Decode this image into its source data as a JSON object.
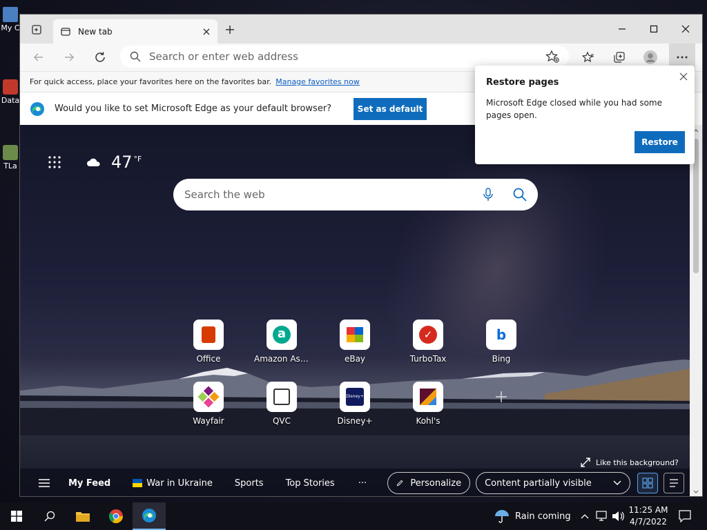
{
  "desktop": {
    "icons": [
      {
        "label": "My C"
      },
      {
        "label": "Data"
      },
      {
        "label": "TLa"
      }
    ]
  },
  "browser": {
    "tab_title": "New tab",
    "address_placeholder": "Search or enter web address",
    "favorites_bar": {
      "text": "For quick access, place your favorites here on the favorites bar.",
      "link": "Manage favorites now"
    },
    "default_prompt": {
      "text": "Would you like to set Microsoft Edge as your default browser?",
      "button": "Set as default"
    },
    "restore_popup": {
      "title": "Restore pages",
      "body": "Microsoft Edge closed while you had some pages open.",
      "button": "Restore"
    }
  },
  "newtab": {
    "weather": {
      "temp": "47",
      "unit": "°F"
    },
    "search_placeholder": "Search the web",
    "quick_links": [
      {
        "label": "Office",
        "color": "#d83b01"
      },
      {
        "label": "Amazon Assi...",
        "color": "#00a88f"
      },
      {
        "label": "eBay",
        "color": "#e53238"
      },
      {
        "label": "TurboTax",
        "color": "#d52b1e"
      },
      {
        "label": "Bing",
        "color": "#0a6dd8"
      },
      {
        "label": "Wayfair",
        "color": "#7f187f"
      },
      {
        "label": "QVC",
        "color": "#333333"
      },
      {
        "label": "Disney+",
        "color": "#0f1b5c"
      },
      {
        "label": "Kohl's",
        "color": "#5c0f2f"
      }
    ],
    "background_link": "Like this background?",
    "feed": {
      "my_feed": "My Feed",
      "war": "War in Ukraine",
      "sports": "Sports",
      "top_stories": "Top Stories",
      "more": "···",
      "personalize": "Personalize",
      "content": "Content partially visible"
    }
  },
  "taskbar": {
    "weather_text": "Rain coming",
    "time": "11:25 AM",
    "date": "4/7/2022"
  }
}
